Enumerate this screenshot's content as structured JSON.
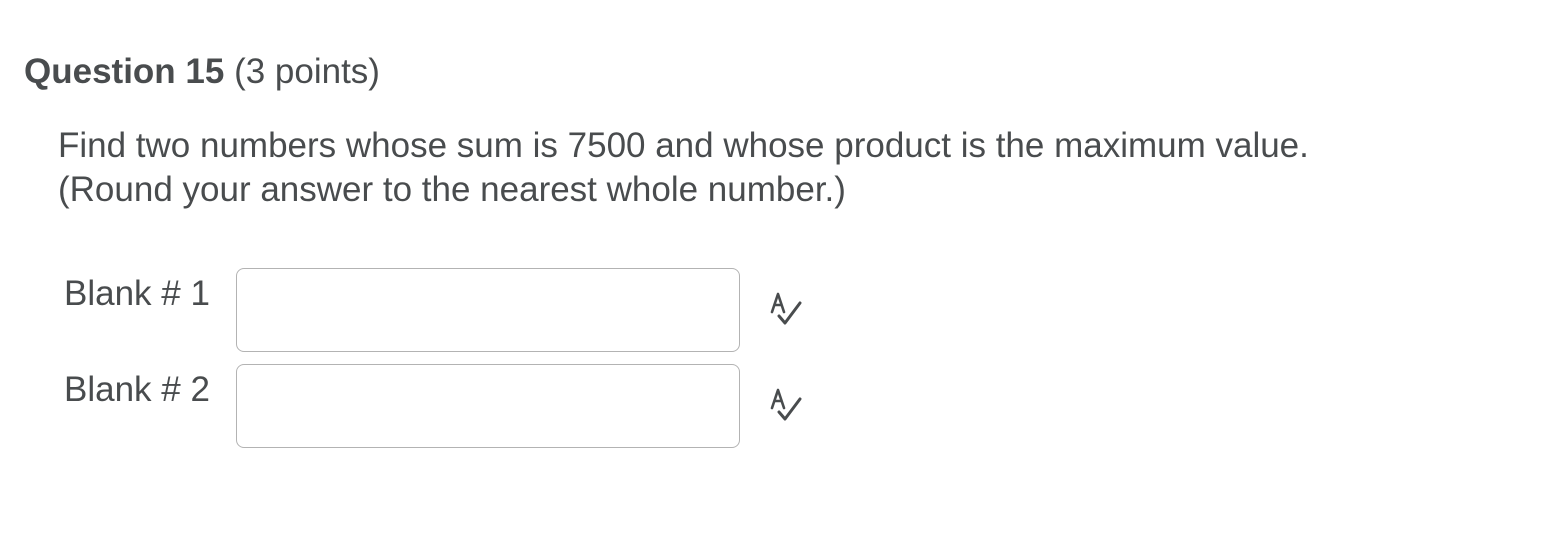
{
  "question": {
    "title": "Question 15",
    "points": "(3 points)",
    "text_line1": "Find two numbers whose sum is 7500 and whose product is the maximum value.",
    "text_line2": "(Round your answer to the nearest whole number.)"
  },
  "blanks": [
    {
      "label": "Blank # 1",
      "value": "",
      "icon": "spell-check-icon"
    },
    {
      "label": "Blank # 2",
      "value": "",
      "icon": "spell-check-icon"
    }
  ]
}
